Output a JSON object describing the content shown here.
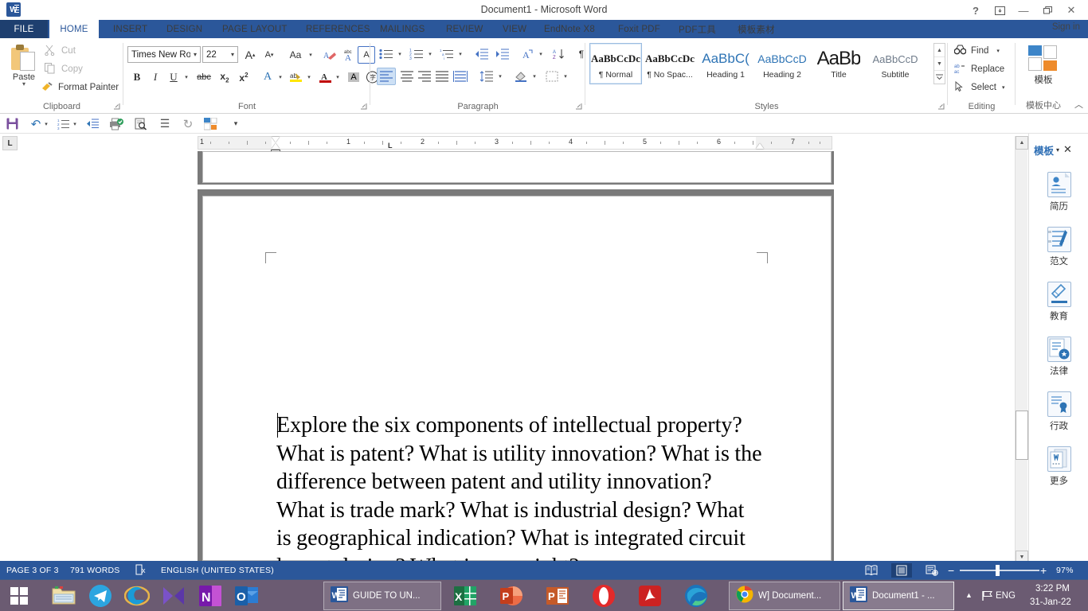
{
  "titlebar": {
    "title": "Document1 - Microsoft Word",
    "help": "?",
    "ribbon_display": "▣",
    "minimize": "—",
    "restore": "❐",
    "close": "✕"
  },
  "tabs": [
    {
      "label": "FILE",
      "type": "file"
    },
    {
      "label": "HOME",
      "type": "active"
    },
    {
      "label": "INSERT",
      "type": "normal"
    },
    {
      "label": "DESIGN",
      "type": "normal"
    },
    {
      "label": "PAGE LAYOUT",
      "type": "normal"
    },
    {
      "label": "REFERENCES",
      "type": "normal"
    },
    {
      "label": "MAILINGS",
      "type": "normal"
    },
    {
      "label": "REVIEW",
      "type": "normal"
    },
    {
      "label": "VIEW",
      "type": "normal"
    },
    {
      "label": "EndNote X8",
      "type": "normal"
    },
    {
      "label": "Foxit PDF",
      "type": "normal"
    },
    {
      "label": "PDF工具",
      "type": "normal"
    },
    {
      "label": "模板素材",
      "type": "normal"
    }
  ],
  "signin": "Sign in",
  "ribbon": {
    "clipboard": {
      "group_label": "Clipboard",
      "paste": "Paste",
      "cut": "Cut",
      "copy": "Copy",
      "format_painter": "Format Painter",
      "launcher": "⌐"
    },
    "font": {
      "group_label": "Font",
      "font_name": "Times New Ro",
      "font_size": "22",
      "grow_font": "A",
      "shrink_font": "A",
      "change_case": "Aa",
      "clear_formatting": "clear-format-icon",
      "phonetic_guide": "abc",
      "char_border": "A",
      "bold": "B",
      "italic": "I",
      "underline": "U",
      "strikethrough": "abc",
      "subscript": "x₂",
      "superscript": "x²",
      "text_effects": "A",
      "highlight": "ab",
      "font_color": "A",
      "char_shading": "A",
      "enclose_char": "㊀",
      "launcher": "⌐"
    },
    "paragraph": {
      "group_label": "Paragraph",
      "bullets": "bullets-icon",
      "numbering": "numbering-icon",
      "multilevel": "multilevel-list-icon",
      "decrease_indent": "decrease-indent-icon",
      "increase_indent": "increase-indent-icon",
      "asian_layout": "asian-layout-icon",
      "sort": "sort-icon",
      "show_marks": "¶",
      "align_left": "align-left-icon",
      "align_center": "align-center-icon",
      "align_right": "align-right-icon",
      "justify": "justify-icon",
      "distributed": "distributed-icon",
      "line_spacing": "line-spacing-icon",
      "shading": "shading-icon",
      "borders": "borders-icon",
      "launcher": "⌐"
    },
    "styles": {
      "group_label": "Styles",
      "launcher": "⌐",
      "items": [
        {
          "preview": "AaBbCcDc",
          "name": "¶ Normal",
          "active": true,
          "color": "#1a1a1a",
          "size": 13
        },
        {
          "preview": "AaBbCcDc",
          "name": "¶ No Spac...",
          "active": false,
          "color": "#1a1a1a",
          "size": 13
        },
        {
          "preview": "AaBbC(",
          "name": "Heading 1",
          "active": false,
          "color": "#2e74b5",
          "size": 16
        },
        {
          "preview": "AaBbCcD",
          "name": "Heading 2",
          "active": false,
          "color": "#2e74b5",
          "size": 14
        },
        {
          "preview": "AaBb",
          "name": "Title",
          "active": false,
          "color": "#1a1a1a",
          "size": 23
        },
        {
          "preview": "AaBbCcD",
          "name": "Subtitle",
          "active": false,
          "color": "#5a5a5a",
          "size": 13
        }
      ],
      "scroll_up": "▲",
      "scroll_down": "▼",
      "scroll_more": "▤"
    },
    "editing": {
      "group_label": "Editing",
      "find": "Find",
      "replace": "Replace",
      "select": "Select"
    },
    "template_center": {
      "group_label": "模板中心",
      "button": "模板",
      "collapse": "︿"
    }
  },
  "qat2": [
    {
      "name": "save-icon",
      "glyph": "💾"
    },
    {
      "name": "undo-icon",
      "glyph": "↶"
    },
    {
      "name": "undo-dropdown-icon",
      "glyph": "▾"
    },
    {
      "name": "numbering-icon",
      "glyph": "⒊"
    },
    {
      "name": "indent-icon",
      "glyph": "⇤"
    },
    {
      "name": "quick-print-icon",
      "glyph": "🖨"
    },
    {
      "name": "print-preview-icon",
      "glyph": "🔍"
    },
    {
      "name": "lines-icon",
      "glyph": "☰"
    },
    {
      "name": "redo-icon",
      "glyph": "↻"
    },
    {
      "name": "template-icon",
      "glyph": "▣"
    },
    {
      "name": "customize-qat-icon",
      "glyph": "▾"
    }
  ],
  "ruler": {
    "corner_tabstop": "L",
    "numbers": [
      "1",
      "1",
      "2",
      "3",
      "4",
      "5",
      "6",
      "7"
    ],
    "tab_stop_marker": "L"
  },
  "document": {
    "paragraph": "Explore the six components of intellectual property? What is patent? What is utility innovation? What is the difference between patent and utility innovation? What is trade mark? What is industrial design? What is geographical indication? What is integrated circuit layout design? What is copyright?"
  },
  "right_panel": {
    "title": "模板",
    "caret": "▾",
    "close": "✕",
    "items": [
      {
        "label": "简历",
        "icon": "resume-template-icon"
      },
      {
        "label": "范文",
        "icon": "essay-template-icon"
      },
      {
        "label": "教育",
        "icon": "education-template-icon"
      },
      {
        "label": "法律",
        "icon": "legal-template-icon"
      },
      {
        "label": "行政",
        "icon": "admin-template-icon"
      },
      {
        "label": "更多",
        "icon": "more-template-icon"
      }
    ]
  },
  "status_bar": {
    "page": "PAGE 3 OF 3",
    "words": "791 WORDS",
    "proofing": "proofing-errors-icon",
    "language": "ENGLISH (UNITED STATES)",
    "view_read": "read-mode-icon",
    "view_print": "print-layout-icon",
    "view_web": "web-layout-icon",
    "zoom_out": "−",
    "zoom_in": "+",
    "zoom_level": "97%"
  },
  "taskbar": {
    "start": "start-button",
    "pinned": [
      {
        "name": "file-explorer-icon"
      },
      {
        "name": "telegram-icon"
      },
      {
        "name": "internet-explorer-icon"
      },
      {
        "name": "media-player-icon"
      },
      {
        "name": "onenote-icon"
      },
      {
        "name": "outlook-icon"
      }
    ],
    "windows": [
      {
        "label": "GUIDE TO UN...",
        "icon": "word-icon",
        "active": false
      },
      {
        "label": "W] Document...",
        "icon": "chrome-icon",
        "active": false
      },
      {
        "label": "Document1 - ...",
        "icon": "word-icon",
        "active": true
      }
    ],
    "pinned2": [
      {
        "name": "excel-icon"
      },
      {
        "name": "powerpoint-icon"
      },
      {
        "name": "publisher-icon"
      },
      {
        "name": "opera-icon"
      },
      {
        "name": "adobe-reader-icon"
      },
      {
        "name": "edge-icon"
      }
    ],
    "tray": {
      "show_hidden": "▲",
      "network": "🏳",
      "language": "ENG",
      "time": "3:22 PM",
      "date": "31-Jan-22"
    }
  }
}
